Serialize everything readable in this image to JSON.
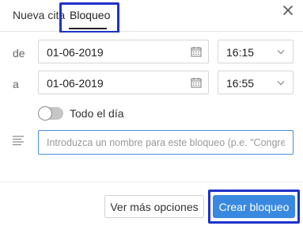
{
  "tabs": {
    "nueva_cita": "Nueva cita",
    "bloqueo": "Bloqueo",
    "active": "bloqueo"
  },
  "from": {
    "label": "de",
    "date": "01-06-2019",
    "time": "16:15"
  },
  "to": {
    "label": "a",
    "date": "01-06-2019",
    "time": "16:55"
  },
  "all_day": {
    "label": "Todo el día",
    "checked": false
  },
  "name_field": {
    "value": "",
    "placeholder": "Introduzca un nombre para este bloqueo (p.e. \"Congreso"
  },
  "footer": {
    "more_options": "Ver más opciones",
    "create": "Crear bloqueo"
  },
  "colors": {
    "primary": "#3a89e0",
    "highlight_border": "#1f32c8"
  },
  "icons": [
    "close-icon",
    "calendar-icon",
    "chevron-down-icon",
    "notes-icon"
  ]
}
